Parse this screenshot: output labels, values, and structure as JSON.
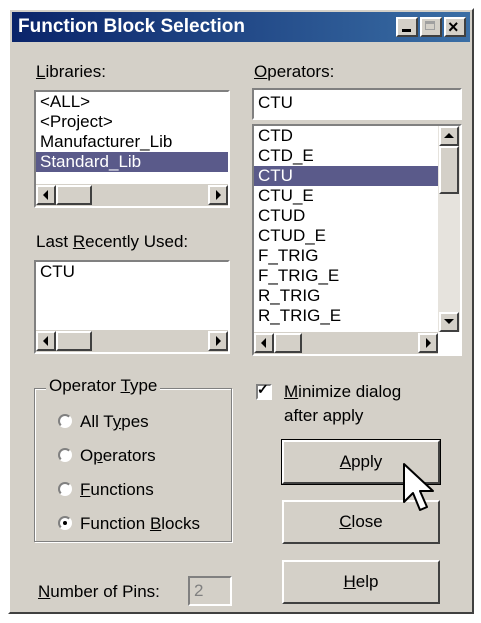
{
  "window": {
    "title": "Function Block Selection"
  },
  "libraries": {
    "label_pre": "",
    "label_key": "L",
    "label_post": "ibraries:",
    "items": [
      "<ALL>",
      "<Project>",
      "Manufacturer_Lib",
      "Standard_Lib"
    ],
    "selected_index": 3
  },
  "operators": {
    "label_pre": "",
    "label_key": "O",
    "label_post": "perators:",
    "input_value": "CTU",
    "items": [
      "CTD",
      "CTD_E",
      "CTU",
      "CTU_E",
      "CTUD",
      "CTUD_E",
      "F_TRIG",
      "F_TRIG_E",
      "R_TRIG",
      "R_TRIG_E"
    ],
    "selected_index": 2
  },
  "recent": {
    "label_pre": "Last ",
    "label_key": "R",
    "label_post": "ecently Used:",
    "items": [
      "CTU"
    ]
  },
  "operator_type": {
    "legend_pre": "Operator ",
    "legend_key": "T",
    "legend_post": "ype",
    "options": [
      {
        "pre": "All T",
        "key": "y",
        "post": "pes",
        "checked": false
      },
      {
        "pre": "O",
        "key": "p",
        "post": "erators",
        "checked": false
      },
      {
        "pre": "",
        "key": "F",
        "post": "unctions",
        "checked": false
      },
      {
        "pre": "Function ",
        "key": "B",
        "post": "locks",
        "checked": true
      }
    ]
  },
  "minimize": {
    "line1_pre": "",
    "line1_key": "M",
    "line1_post": "inimize dialog",
    "line2": "after apply",
    "checked": true
  },
  "pins": {
    "label_pre": "",
    "label_key": "N",
    "label_post": "umber of Pins:",
    "value": "2"
  },
  "buttons": {
    "apply": {
      "key": "A",
      "post": "pply"
    },
    "close": {
      "key": "C",
      "post": "lose"
    },
    "help": {
      "key": "H",
      "post": "elp"
    }
  },
  "colors": {
    "titlebar": "#0a246a",
    "face": "#d4d0c8",
    "selection": "#5a5a8a"
  }
}
